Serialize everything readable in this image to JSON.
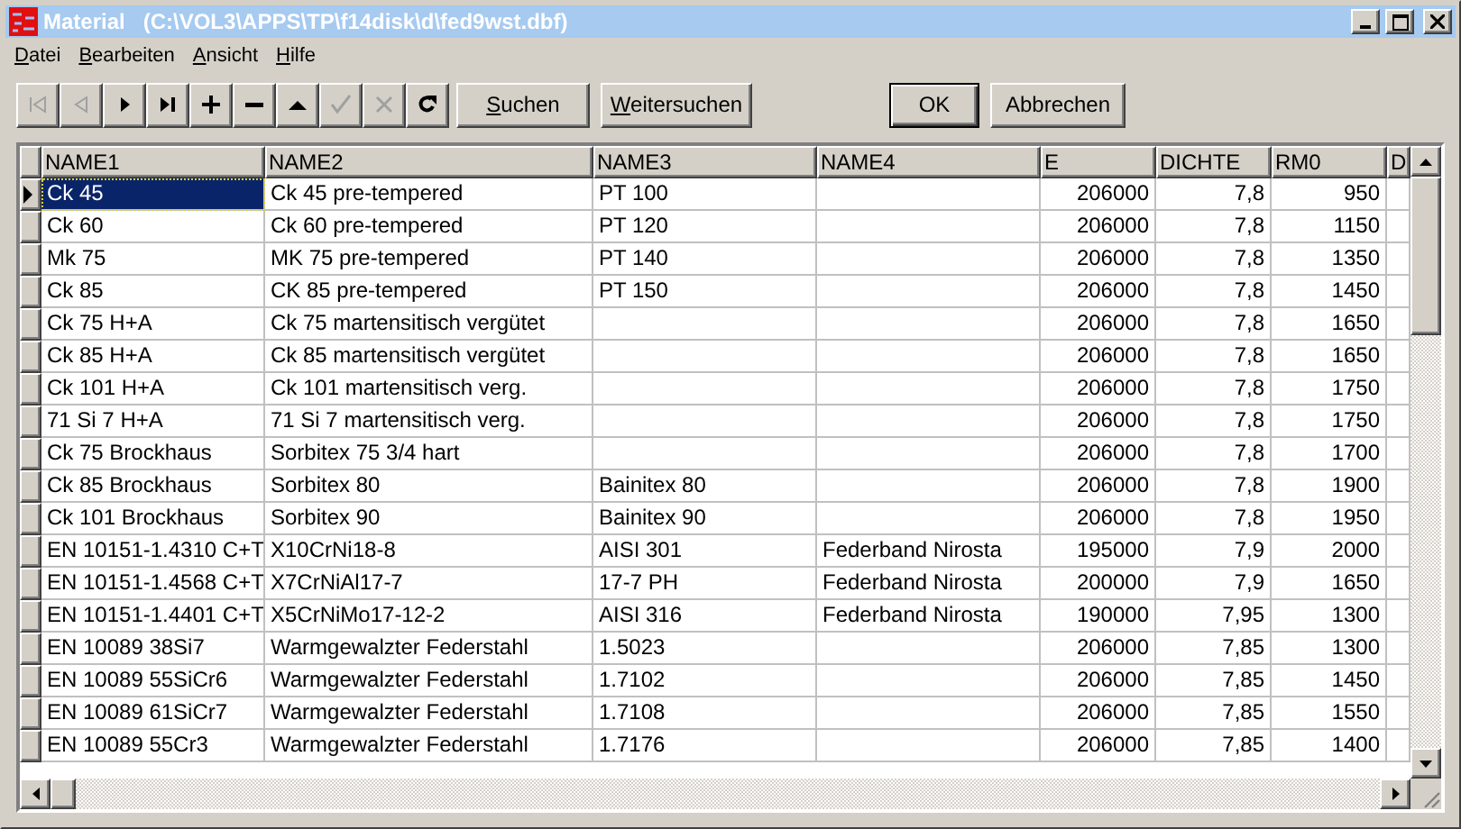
{
  "window": {
    "title": "Material   (C:\\VOL3\\APPS\\TP\\f14disk\\d\\fed9wst.dbf)"
  },
  "menu": [
    "Datei",
    "Bearbeiten",
    "Ansicht",
    "Hilfe"
  ],
  "navigator": [
    {
      "kind": "first",
      "disabled": true
    },
    {
      "kind": "prior",
      "disabled": true
    },
    {
      "kind": "next",
      "disabled": false
    },
    {
      "kind": "last",
      "disabled": false
    },
    {
      "kind": "insert",
      "disabled": false
    },
    {
      "kind": "delete",
      "disabled": false
    },
    {
      "kind": "edit",
      "disabled": false
    },
    {
      "kind": "post",
      "disabled": true
    },
    {
      "kind": "cancel",
      "disabled": true
    },
    {
      "kind": "refresh",
      "disabled": false
    }
  ],
  "search_buttons": [
    "Suchen",
    "Weitersuchen"
  ],
  "dialog_buttons": [
    {
      "label": "OK",
      "default": true
    },
    {
      "label": "Abbrechen",
      "default": false
    }
  ],
  "table": {
    "columns": [
      "NAME1",
      "NAME2",
      "NAME3",
      "NAME4",
      "E",
      "DICHTE",
      "RM0",
      "D"
    ],
    "rows": [
      {
        "selected": true,
        "cells": [
          "Ck 45",
          "Ck 45 pre-tempered",
          "PT 100",
          "",
          "206000",
          "7,8",
          "950"
        ]
      },
      {
        "selected": false,
        "cells": [
          "Ck 60",
          "Ck 60 pre-tempered",
          "PT 120",
          "",
          "206000",
          "7,8",
          "1150"
        ]
      },
      {
        "selected": false,
        "cells": [
          "Mk 75",
          "MK 75 pre-tempered",
          "PT 140",
          "",
          "206000",
          "7,8",
          "1350"
        ]
      },
      {
        "selected": false,
        "cells": [
          "Ck 85",
          "CK 85 pre-tempered",
          "PT 150",
          "",
          "206000",
          "7,8",
          "1450"
        ]
      },
      {
        "selected": false,
        "cells": [
          "Ck 75 H+A",
          "Ck 75 martensitisch vergütet",
          "",
          "",
          "206000",
          "7,8",
          "1650"
        ]
      },
      {
        "selected": false,
        "cells": [
          "Ck 85 H+A",
          "Ck 85 martensitisch vergütet",
          "",
          "",
          "206000",
          "7,8",
          "1650"
        ]
      },
      {
        "selected": false,
        "cells": [
          "Ck 101 H+A",
          "Ck 101 martensitisch verg.",
          "",
          "",
          "206000",
          "7,8",
          "1750"
        ]
      },
      {
        "selected": false,
        "cells": [
          "71 Si 7 H+A",
          "71 Si 7 martensitisch verg.",
          "",
          "",
          "206000",
          "7,8",
          "1750"
        ]
      },
      {
        "selected": false,
        "cells": [
          "Ck 75 Brockhaus",
          "Sorbitex 75  3/4 hart",
          "",
          "",
          "206000",
          "7,8",
          "1700"
        ]
      },
      {
        "selected": false,
        "cells": [
          "Ck 85 Brockhaus",
          "Sorbitex 80",
          "Bainitex 80",
          "",
          "206000",
          "7,8",
          "1900"
        ]
      },
      {
        "selected": false,
        "cells": [
          "Ck 101 Brockhaus",
          "Sorbitex 90",
          "Bainitex 90",
          "",
          "206000",
          "7,8",
          "1950"
        ]
      },
      {
        "selected": false,
        "cells": [
          "EN 10151-1.4310 C+T",
          "X10CrNi18-8",
          "AISI 301",
          "Federband Nirosta",
          "195000",
          "7,9",
          "2000"
        ]
      },
      {
        "selected": false,
        "cells": [
          "EN 10151-1.4568 C+T",
          "X7CrNiAl17-7",
          "17-7 PH",
          "Federband Nirosta",
          "200000",
          "7,9",
          "1650"
        ]
      },
      {
        "selected": false,
        "cells": [
          "EN 10151-1.4401 C+T",
          "X5CrNiMo17-12-2",
          "AISI 316",
          "Federband Nirosta",
          "190000",
          "7,95",
          "1300"
        ]
      },
      {
        "selected": false,
        "cells": [
          "EN 10089 38Si7",
          "Warmgewalzter Federstahl",
          "1.5023",
          "",
          "206000",
          "7,85",
          "1300"
        ]
      },
      {
        "selected": false,
        "cells": [
          "EN 10089 55SiCr6",
          "Warmgewalzter Federstahl",
          "1.7102",
          "",
          "206000",
          "7,85",
          "1450"
        ]
      },
      {
        "selected": false,
        "cells": [
          "EN 10089 61SiCr7",
          "Warmgewalzter Federstahl",
          "1.7108",
          "",
          "206000",
          "7,85",
          "1550"
        ]
      },
      {
        "selected": false,
        "cells": [
          "EN 10089 55Cr3",
          "Warmgewalzter Federstahl",
          "1.7176",
          "",
          "206000",
          "7,85",
          "1400"
        ]
      }
    ]
  }
}
